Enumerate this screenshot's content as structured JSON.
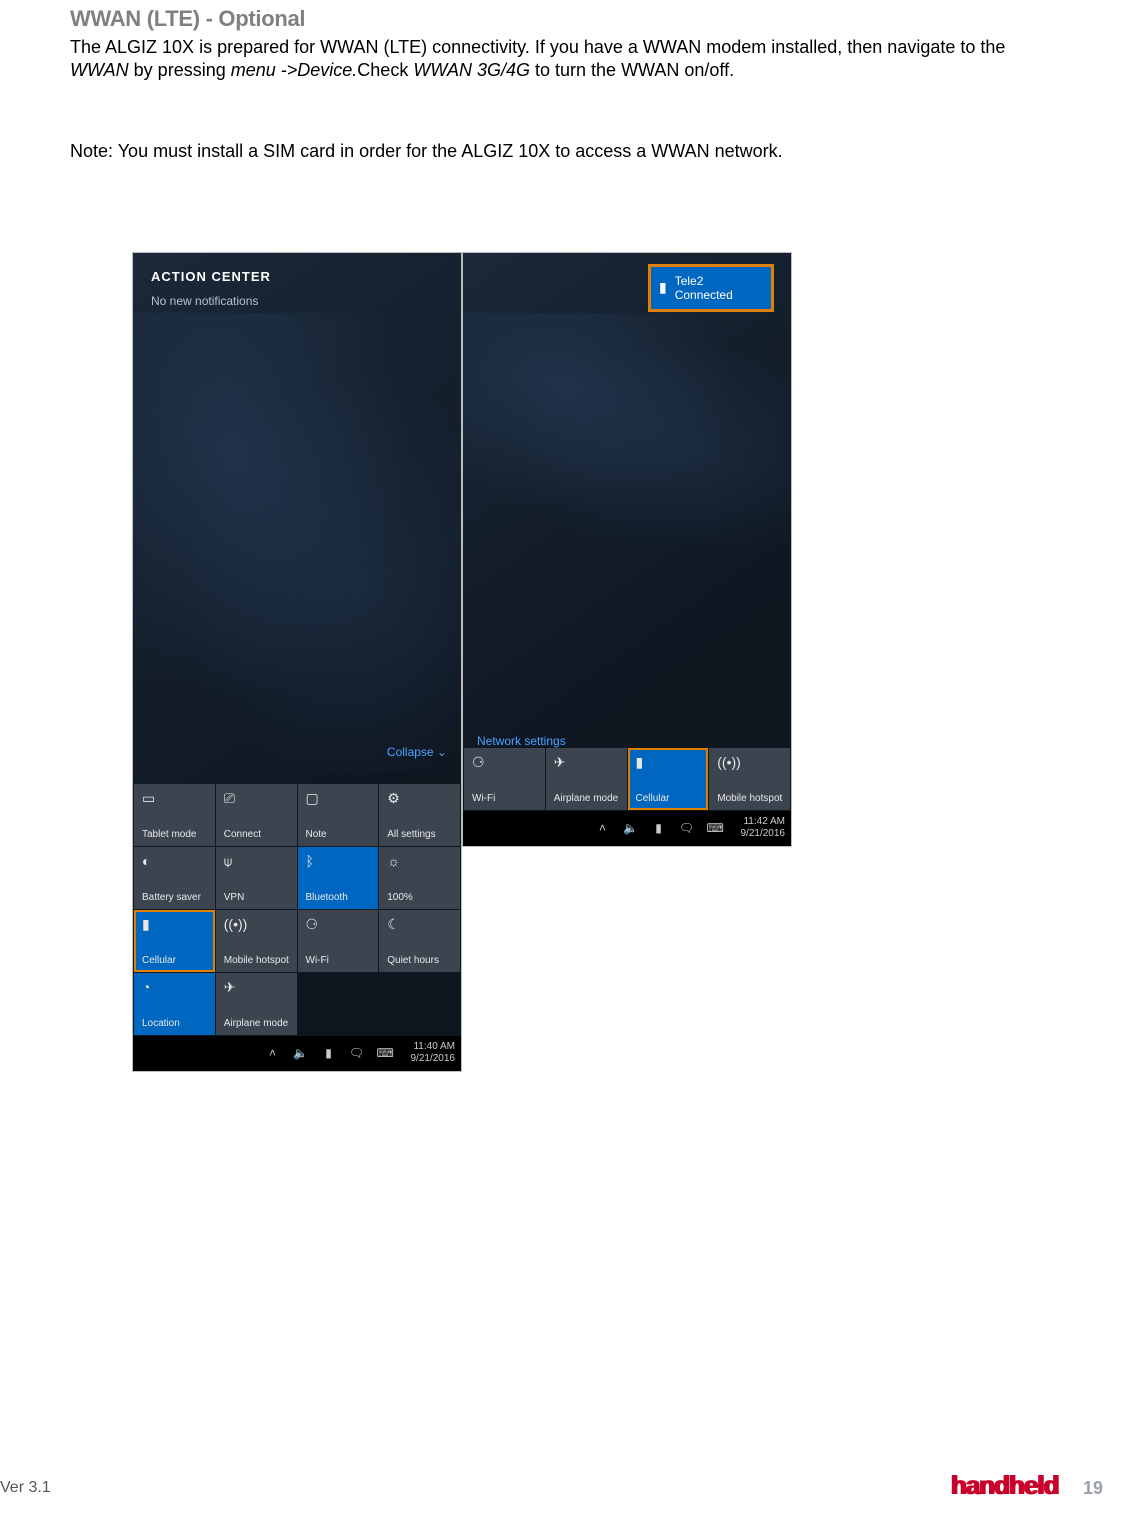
{
  "heading": "WWAN (LTE) - Optional",
  "body_parts": {
    "p1a": "The ALGIZ 10X is prepared for WWAN (LTE) connectivity. If you have a WWAN modem installed, then navigate to the ",
    "p1b_em": "WWAN",
    "p1c": " by pressing ",
    "p1d_em": "menu ->Device.",
    "p1e": "Check ",
    "p1f_em": "WWAN 3G/4G",
    "p1g": " to turn the WWAN on/off."
  },
  "note": "Note: You must install a SIM card in order for the ALGIZ 10X to access a WWAN network.",
  "action_center": {
    "title": "ACTION CENTER",
    "no_notif": "No new notifications",
    "collapse": "Collapse ⌄",
    "tiles": [
      {
        "label": "Tablet mode",
        "icon": "▭",
        "active": false
      },
      {
        "label": "Connect",
        "icon": "⎚",
        "active": false
      },
      {
        "label": "Note",
        "icon": "▢",
        "active": false
      },
      {
        "label": "All settings",
        "icon": "⚙",
        "active": false
      },
      {
        "label": "Battery saver",
        "icon": "◐",
        "active": false
      },
      {
        "label": "VPN",
        "icon": "⍦",
        "active": false
      },
      {
        "label": "Bluetooth",
        "icon": "ᛒ",
        "active": true
      },
      {
        "label": "100%",
        "icon": "☼",
        "active": false
      },
      {
        "label": "Cellular",
        "icon": "▮",
        "active": true,
        "highlight": true
      },
      {
        "label": "Mobile hotspot",
        "icon": "((•))",
        "active": false
      },
      {
        "label": "Wi-Fi",
        "icon": "⚆",
        "active": false
      },
      {
        "label": "Quiet hours",
        "icon": "☾",
        "active": false
      },
      {
        "label": "Location",
        "icon": "◔",
        "active": true
      },
      {
        "label": "Airplane mode",
        "icon": "✈",
        "active": false
      }
    ],
    "time": "11:40 AM",
    "date": "9/21/2016"
  },
  "network_panel": {
    "callout_carrier": "Tele2",
    "callout_status": "Connected",
    "settings_link": "Network settings",
    "tiles": [
      {
        "label": "Wi-Fi",
        "icon": "⚆",
        "active": false
      },
      {
        "label": "Airplane mode",
        "icon": "✈",
        "active": false
      },
      {
        "label": "Cellular",
        "icon": "▮",
        "active": true,
        "highlight": true
      },
      {
        "label": "Mobile hotspot",
        "icon": "((•))",
        "active": false
      }
    ],
    "time": "11:42 AM",
    "date": "9/21/2016"
  },
  "tray_icons": [
    "˄",
    "🔈",
    "▮",
    "🗨",
    "⌨"
  ],
  "footer": {
    "ver": "Ver 3.1",
    "brand": "handheld",
    "page": "19"
  }
}
